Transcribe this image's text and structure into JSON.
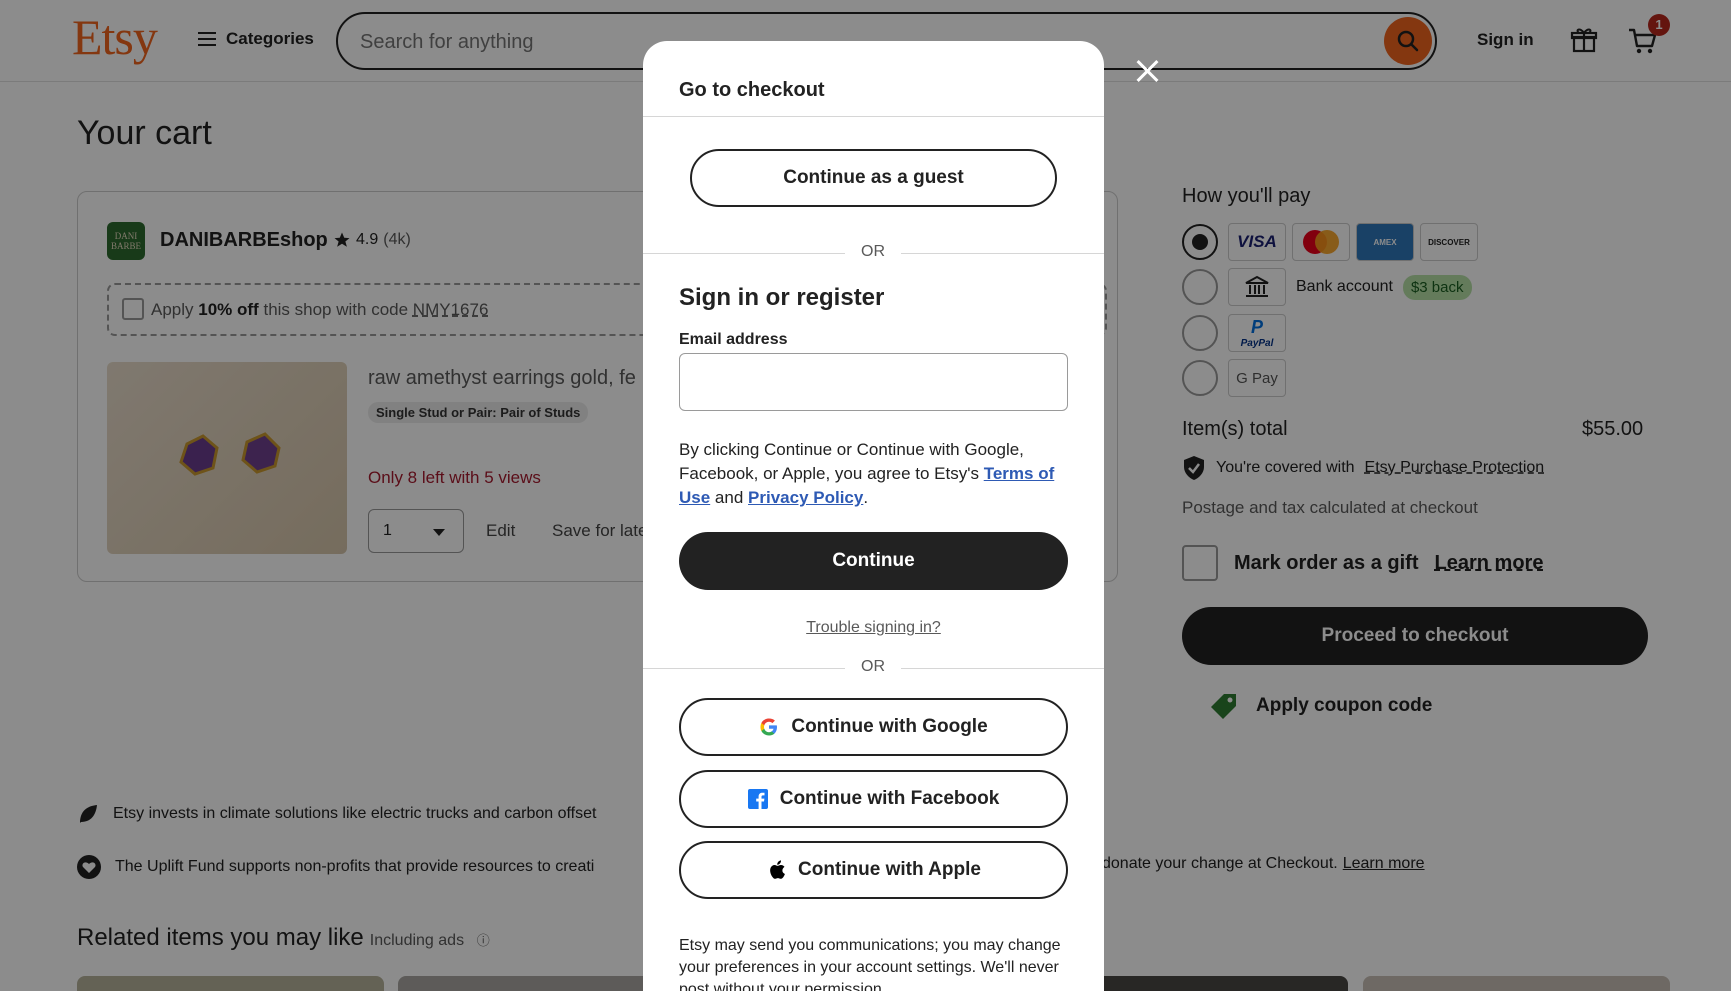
{
  "header": {
    "logo": "Etsy",
    "categories_label": "Categories",
    "search_placeholder": "Search for anything",
    "signin_label": "Sign in",
    "cart_count": "1"
  },
  "page": {
    "title": "Your cart"
  },
  "shop": {
    "avatar_text": "DANI BARBE",
    "name": "DANIBARBEshop",
    "rating": "4.9",
    "rating_count": "(4k)",
    "coupon_prefix": "Apply",
    "coupon_discount": "10% off",
    "coupon_middle": "this shop with code",
    "coupon_code": "NMY1676"
  },
  "product": {
    "title": "raw amethyst earrings gold, fe",
    "variant": "Single Stud or Pair: Pair of Studs",
    "stock_note": "Only 8 left with 5 views",
    "quantity": "1",
    "edit_label": "Edit",
    "save_label": "Save for late"
  },
  "payment": {
    "title": "How you'll pay",
    "card_logos": [
      "VISA",
      "MC",
      "AMEX",
      "DISCOVER"
    ],
    "bank_label": "Bank account",
    "bank_badge": "$3 back",
    "paypal_label": "PayPal",
    "gpay_label": "G Pay",
    "items_total_label": "Item(s) total",
    "items_total_value": "$55.00",
    "protection_prefix": "You're covered with",
    "protection_link": "Etsy Purchase Protection",
    "postage_note": "Postage and tax calculated at checkout",
    "gift_label": "Mark order as a gift",
    "gift_learn_more": "Learn more",
    "proceed_label": "Proceed to checkout",
    "coupon_label": "Apply coupon code"
  },
  "impact": {
    "climate_text": "Etsy invests in climate solutions like electric trucks and carbon offset",
    "uplift_text_start": "The Uplift Fund supports non-profits that provide resources to creati",
    "uplift_text_end": "donate your change at Checkout.",
    "uplift_link": "Learn more"
  },
  "related": {
    "title": "Related items you may like",
    "ads_label": "Including ads"
  },
  "modal": {
    "title": "Go to checkout",
    "guest_label": "Continue as a guest",
    "or_label": "OR",
    "signin_title": "Sign in or register",
    "email_label": "Email address",
    "email_value": "",
    "legal_text": "By clicking Continue or Continue with Google, Facebook, or Apple, you agree to Etsy's",
    "terms_link": "Terms of Use",
    "legal_and": "and",
    "privacy_link": "Privacy Policy",
    "continue_label": "Continue",
    "trouble_label": "Trouble signing in?",
    "google_label": "Continue with Google",
    "facebook_label": "Continue with Facebook",
    "apple_label": "Continue with Apple",
    "footer_text": "Etsy may send you communications; you may change your preferences in your account settings. We'll never post without your permission."
  },
  "colors": {
    "brand": "#f1641e",
    "primary_button": "#222222",
    "alert": "#a61a2e",
    "link": "#2e5ab4"
  }
}
